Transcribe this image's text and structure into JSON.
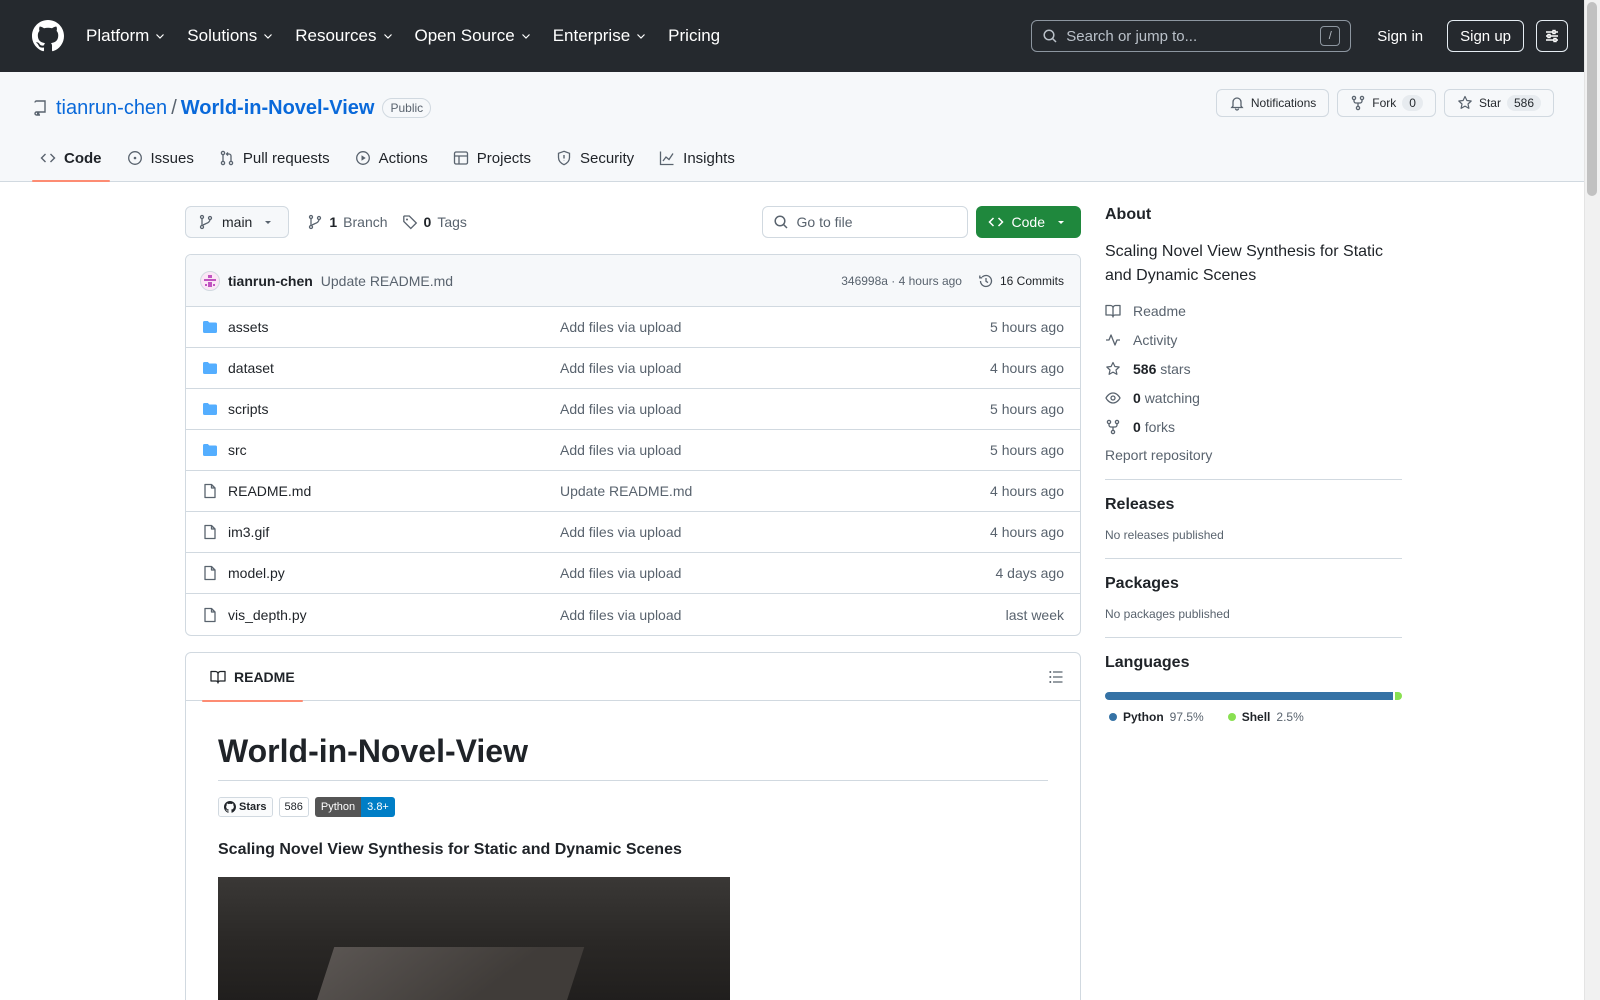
{
  "header": {
    "nav": [
      "Platform",
      "Solutions",
      "Resources",
      "Open Source",
      "Enterprise",
      "Pricing"
    ],
    "search_placeholder": "Search or jump to...",
    "search_key": "/",
    "signin": "Sign in",
    "signup": "Sign up"
  },
  "repo": {
    "owner": "tianrun-chen",
    "separator": "/",
    "name": "World-in-Novel-View",
    "visibility": "Public",
    "notifications": "Notifications",
    "fork_label": "Fork",
    "fork_count": "0",
    "star_label": "Star",
    "star_count": "586",
    "tabs": [
      "Code",
      "Issues",
      "Pull requests",
      "Actions",
      "Projects",
      "Security",
      "Insights"
    ]
  },
  "filenav": {
    "branch": "main",
    "branch_count": "1",
    "branch_label": "Branch",
    "tag_count": "0",
    "tag_label": "Tags",
    "goto_placeholder": "Go to file",
    "code_button": "Code"
  },
  "commit": {
    "author": "tianrun-chen",
    "message": "Update README.md",
    "meta": "346998a · 4 hours ago",
    "commits": "16 Commits"
  },
  "files": [
    {
      "name": "assets",
      "type": "folder",
      "commit": "Add files via upload",
      "date": "5 hours ago"
    },
    {
      "name": "dataset",
      "type": "folder",
      "commit": "Add files via upload",
      "date": "4 hours ago"
    },
    {
      "name": "scripts",
      "type": "folder",
      "commit": "Add files via upload",
      "date": "5 hours ago"
    },
    {
      "name": "src",
      "type": "folder",
      "commit": "Add files via upload",
      "date": "5 hours ago"
    },
    {
      "name": "README.md",
      "type": "file",
      "commit": "Update README.md",
      "date": "4 hours ago"
    },
    {
      "name": "im3.gif",
      "type": "file",
      "commit": "Add files via upload",
      "date": "4 hours ago"
    },
    {
      "name": "model.py",
      "type": "file",
      "commit": "Add files via upload",
      "date": "4 days ago"
    },
    {
      "name": "vis_depth.py",
      "type": "file",
      "commit": "Add files via upload",
      "date": "last week"
    }
  ],
  "readme": {
    "tab": "README",
    "title": "World-in-Novel-View",
    "badge_stars_label": "Stars",
    "badge_stars_count": "586",
    "badge_python_left": "Python",
    "badge_python_right": "3.8+",
    "subtitle": "Scaling Novel View Synthesis for Static and Dynamic Scenes"
  },
  "about": {
    "heading": "About",
    "description": "Scaling Novel View Synthesis for Static and Dynamic Scenes",
    "readme": "Readme",
    "activity": "Activity",
    "stars_count": "586",
    "stars_label": "stars",
    "watching_count": "0",
    "watching_label": "watching",
    "forks_count": "0",
    "forks_label": "forks",
    "report": "Report repository"
  },
  "releases": {
    "heading": "Releases",
    "text": "No releases published"
  },
  "packages": {
    "heading": "Packages",
    "text": "No packages published"
  },
  "languages": {
    "heading": "Languages",
    "items": [
      {
        "name": "Python",
        "percent": "97.5%",
        "value": 97.5,
        "color": "#3572A5"
      },
      {
        "name": "Shell",
        "percent": "2.5%",
        "value": 2.5,
        "color": "#89e051"
      }
    ]
  }
}
